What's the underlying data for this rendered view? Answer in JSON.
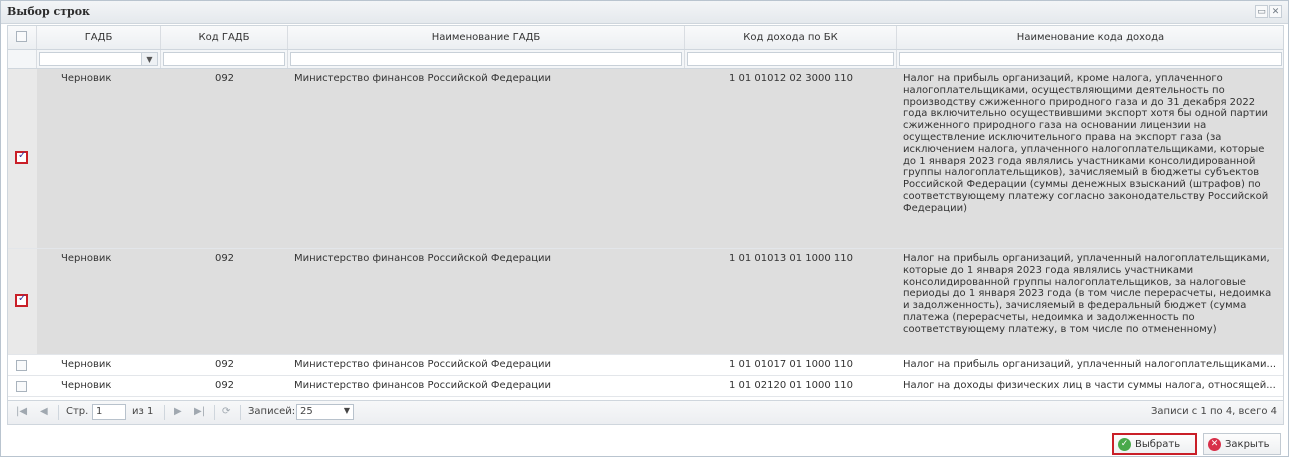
{
  "window": {
    "title": "Выбор строк",
    "tools": [
      {
        "icon": "restore-icon",
        "glyph": "▭"
      },
      {
        "icon": "close-icon",
        "glyph": "✕"
      }
    ]
  },
  "grid": {
    "columns": [
      "",
      "ГАДБ",
      "Код ГАДБ",
      "Наименование ГАДБ",
      "Код дохода по БК",
      "Наименование кода дохода"
    ],
    "rows": [
      {
        "checked": true,
        "status": "Черновик",
        "code": "092",
        "name": "Министерство финансов Российской Федерации",
        "bk": "1 01 01012 02 3000 110",
        "desc": "Налог на прибыль организаций, кроме налога, уплаченного налогоплательщиками, осуществляющими деятельность по производству сжиженного природного газа и до 31 декабря 2022 года включительно осуществившими экспорт хотя бы одной партии сжиженного природного газа на основании лицензии на осуществление исключительного права на экспорт газа (за исключением налога, уплаченного налогоплательщиками, которые до 1 января 2023 года являлись участниками консолидированной группы налогоплательщиков), зачисляемый в бюджеты субъектов Российской Федерации (суммы денежных взысканий (штрафов) по соответствующему платежу согласно законодательству Российской Федерации)"
      },
      {
        "checked": true,
        "status": "Черновик",
        "code": "092",
        "name": "Министерство финансов Российской Федерации",
        "bk": "1 01 01013 01 1000 110",
        "desc": "Налог на прибыль организаций, уплаченный налогоплательщиками, которые до 1 января 2023 года являлись участниками консолидированной группы налогоплательщиков, за налоговые периоды до 1 января 2023 года (в том числе перерасчеты, недоимка и задолженность), зачисляемый в федеральный бюджет (сумма платежа (перерасчеты, недоимка и задолженность по соответствующему платежу, в том числе по отмененному)"
      },
      {
        "checked": false,
        "status": "Черновик",
        "code": "092",
        "name": "Министерство финансов Российской Федерации",
        "bk": "1 01 01017 01 1000 110",
        "desc": "Налог на прибыль организаций, уплаченный налогоплательщиками..."
      },
      {
        "checked": false,
        "status": "Черновик",
        "code": "092",
        "name": "Министерство финансов Российской Федерации",
        "bk": "1 01 02120 01 1000 110",
        "desc": "Налог на доходы физических лиц в части суммы налога, относящей..."
      }
    ]
  },
  "pager": {
    "page_label": "Стр.",
    "page_value": "1",
    "of_label": "из 1",
    "records_label": "Записей:",
    "records_value": "25",
    "info": "Записи с 1 по 4, всего 4"
  },
  "buttons": {
    "select_label": "Выбрать",
    "close_label": "Закрыть"
  },
  "colors": {
    "selected_row": "#dedede",
    "highlight_border": "#c91f28"
  }
}
